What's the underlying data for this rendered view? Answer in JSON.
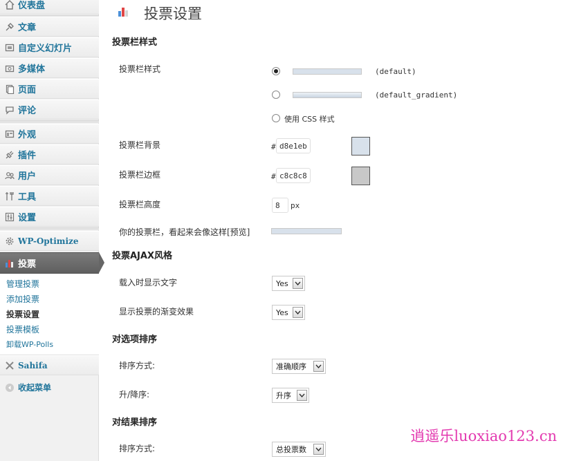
{
  "sidebar": {
    "items": [
      {
        "label": "仪表盘",
        "icon": "home-icon"
      },
      {
        "label": "文章",
        "icon": "pin-icon"
      },
      {
        "label": "自定义幻灯片",
        "icon": "slides-icon"
      },
      {
        "label": "多媒体",
        "icon": "media-icon"
      },
      {
        "label": "页面",
        "icon": "pages-icon"
      },
      {
        "label": "评论",
        "icon": "comment-icon"
      },
      {
        "label": "外观",
        "icon": "appearance-icon"
      },
      {
        "label": "插件",
        "icon": "plugin-icon"
      },
      {
        "label": "用户",
        "icon": "users-icon"
      },
      {
        "label": "工具",
        "icon": "tools-icon"
      },
      {
        "label": "设置",
        "icon": "settings-icon"
      },
      {
        "label": "WP-Optimize",
        "icon": "gear-icon"
      },
      {
        "label": "投票",
        "icon": "poll-icon"
      },
      {
        "label": "Sahifa",
        "icon": "wrench-icon"
      }
    ],
    "submenu": [
      "管理投票",
      "添加投票",
      "投票设置",
      "投票模板",
      "卸载WP-Polls"
    ],
    "collapse_label": "收起菜单"
  },
  "page": {
    "title": "投票设置",
    "sections": {
      "bar_style": "投票栏样式",
      "ajax": "投票AJAX风格",
      "sort_answers": "对选项排序",
      "sort_results": "对结果排序"
    }
  },
  "bar_style": {
    "label": "投票栏样式",
    "options": [
      {
        "name": "(default)",
        "checked": true
      },
      {
        "name": "(default_gradient)",
        "checked": false
      }
    ],
    "css_option": "使用 CSS 样式",
    "background_label": "投票栏背景",
    "background_value": "d8e1eb",
    "background_color": "#d8e1eb",
    "border_label": "投票栏边框",
    "border_value": "c8c8c8",
    "border_color": "#c8c8c8",
    "height_label": "投票栏高度",
    "height_value": "8",
    "height_unit": "px",
    "preview_label": "你的投票栏，看起来会像这样[预览]",
    "hash": "#"
  },
  "ajax": {
    "loading_label": "载入时显示文字",
    "loading_value": "Yes",
    "fade_label": "显示投票的渐变效果",
    "fade_value": "Yes"
  },
  "sort_answers": {
    "method_label": "排序方式:",
    "method_value": "准确顺序",
    "order_label": "升/降序:",
    "order_value": "升序"
  },
  "sort_results": {
    "method_label": "排序方式:",
    "method_value": "总投票数"
  },
  "watermark": "逍遥乐luoxiao123.cn"
}
